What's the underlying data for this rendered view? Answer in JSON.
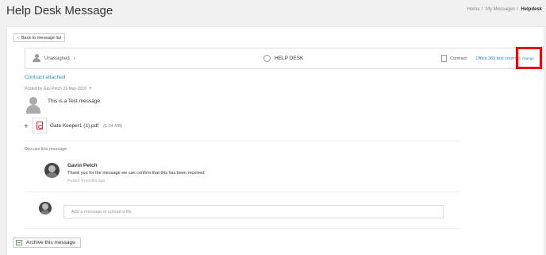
{
  "header": {
    "title": "Help Desk Message",
    "breadcrumb": [
      "Home",
      "My Messages",
      "Helpdesk"
    ]
  },
  "back_button": {
    "label": "Back to message list",
    "icon": "chevron-left-icon"
  },
  "topbar": {
    "assignee": "Unassigned",
    "department": "HELP DESK",
    "contract_label": "Contract:",
    "contract_value": "Office 365 test contract",
    "change_label": "change"
  },
  "message": {
    "contract_attached": "Contract attached",
    "posted_by": "Posted by Gav Petch 21-May-2019",
    "body": "This is a Test message",
    "attachment": {
      "name": "Gate Keeper1 (1).pdf",
      "size": "(1.04 MB)"
    }
  },
  "discussion": {
    "label": "Discuss this message",
    "comments": [
      {
        "author": "Gavin Petch",
        "text": "Thank you for the message we can confirm that this has been received",
        "time": "Posted 4 months ago"
      }
    ],
    "reply_placeholder": "Add a message or upload a file"
  },
  "footer": {
    "archive_label": "Archive this message"
  },
  "colors": {
    "link": "#2b8fc9",
    "highlight": "#ee0000",
    "pdf": "#dd3333"
  }
}
